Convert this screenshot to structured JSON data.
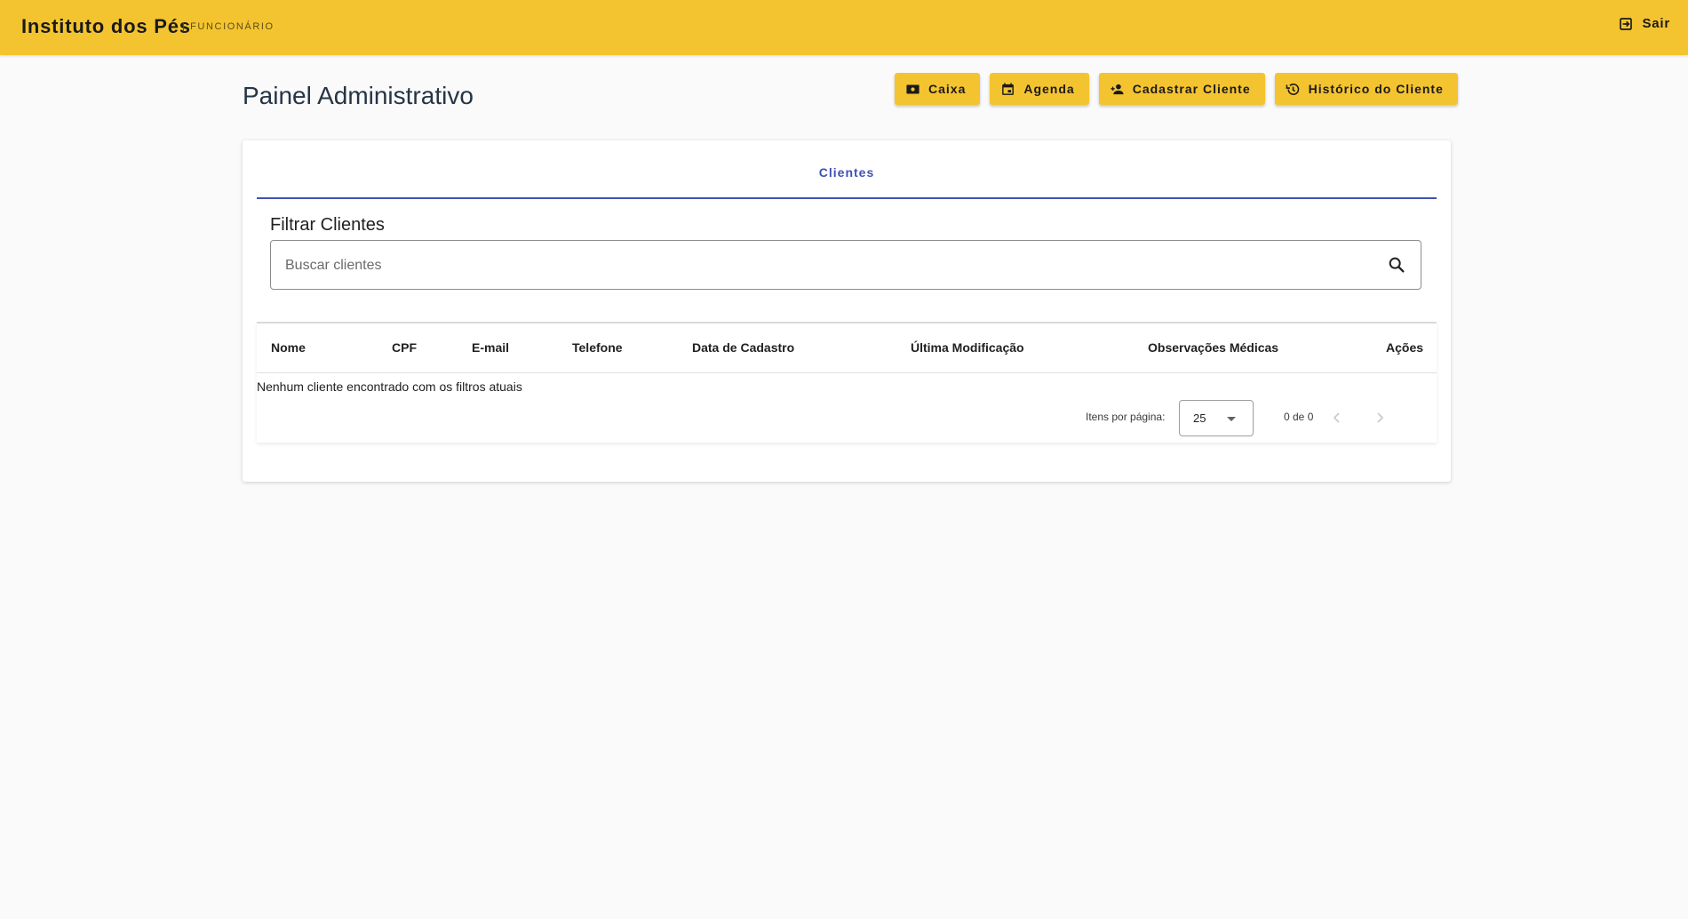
{
  "header": {
    "brand": "Instituto dos Pés",
    "role": "| FUNCIONÁRIO",
    "logout_label": "Sair"
  },
  "page": {
    "title": "Painel Administrativo"
  },
  "actions": {
    "caixa": "Caixa",
    "agenda": "Agenda",
    "cadastrar_cliente": "Cadastrar Cliente",
    "historico_cliente": "Histórico do Cliente"
  },
  "tabs": {
    "active": "Clientes"
  },
  "filter": {
    "title": "Filtrar Clientes",
    "placeholder": "Buscar clientes",
    "value": ""
  },
  "table": {
    "columns": [
      "Nome",
      "CPF",
      "E-mail",
      "Telefone",
      "Data de Cadastro",
      "Última Modificação",
      "Observações Médicas",
      "Ações"
    ],
    "rows": [],
    "empty_message": "Nenhum cliente encontrado com os filtros atuais"
  },
  "paginator": {
    "items_label": "Itens por página:",
    "page_size": "25",
    "range": "0 de 0"
  },
  "colors": {
    "accent": "#f4c430",
    "tab_active": "#3f51b5",
    "background": "#fafafa"
  },
  "icons": {
    "logout": "logout-icon",
    "caixa": "cash-icon",
    "agenda": "calendar-icon",
    "cadastrar_cliente": "person-add-icon",
    "historico_cliente": "history-icon",
    "search": "search-icon",
    "prev": "chevron-left-icon",
    "next": "chevron-right-icon"
  }
}
